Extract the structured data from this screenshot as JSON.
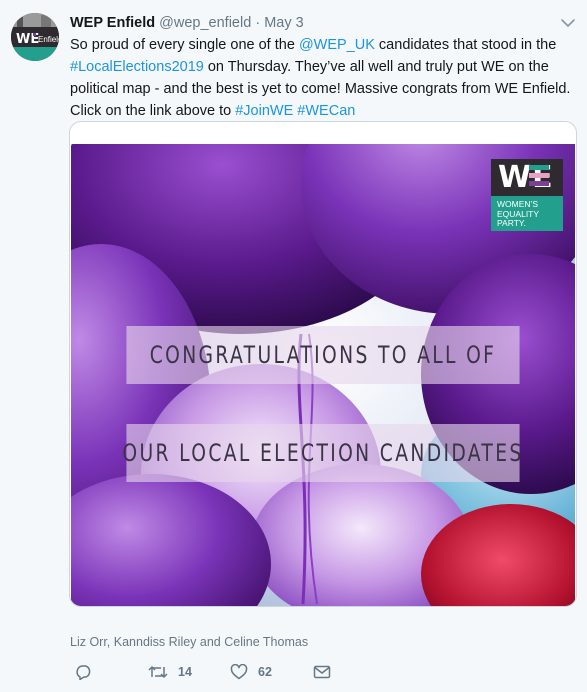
{
  "tweet": {
    "author_name": "WEP Enfield",
    "author_handle": "@wep_enfield",
    "separator": "·",
    "date": "May 3",
    "text_parts": {
      "p1": "So proud of every single one of the ",
      "mention": "@WEP_UK",
      "p2": " candidates that stood in the ",
      "hashtag1": "#LocalElections2019",
      "p3": " on Thursday. They’ve all well and truly put WE on the political map - and the best is yet to come! Massive congrats from WE Enfield. Click on the link above to ",
      "hashtag2": "#JoinWE",
      "space": " ",
      "hashtag3": "#WECan"
    },
    "image": {
      "banner_line1": "CONGRATULATIONS TO ALL OF",
      "banner_line2": "OUR LOCAL ELECTION CANDIDATES",
      "logo_mark": "WE",
      "logo_text": [
        "WOMEN’S",
        "EQUALITY",
        "PARTY."
      ]
    },
    "tagged_people": "Liz Orr, Kanndiss Riley and Celine Thomas",
    "actions": {
      "reply_icon": "reply-icon",
      "retweet_icon": "retweet-icon",
      "retweet_count": "14",
      "like_icon": "heart-icon",
      "like_count": "62",
      "dm_icon": "envelope-icon"
    },
    "colors": {
      "link": "#1b95e0",
      "muted": "#657786",
      "brand_green": "#22a08d"
    }
  }
}
